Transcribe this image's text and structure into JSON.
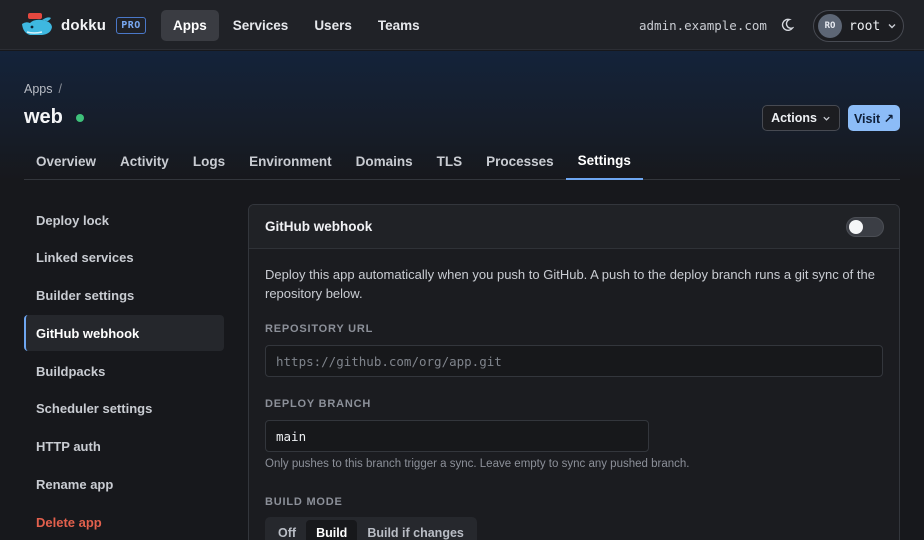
{
  "nav": {
    "brand": "dokku",
    "badge": "PRO",
    "links": [
      "Apps",
      "Services",
      "Users",
      "Teams"
    ],
    "active": "Apps",
    "host": "admin.example.com",
    "user_initials": "RO",
    "user_name": "root"
  },
  "header": {
    "breadcrumb": "Apps",
    "breadcrumb_sep": "/",
    "app_name": "web",
    "status": "running",
    "actions_label": "Actions",
    "visit_label": "Visit ↗"
  },
  "tabs": [
    "Overview",
    "Activity",
    "Logs",
    "Environment",
    "Domains",
    "TLS",
    "Processes",
    "Settings"
  ],
  "active_tab": "Settings",
  "sidebar": {
    "items": [
      "Deploy lock",
      "Linked services",
      "Builder settings",
      "GitHub webhook",
      "Buildpacks",
      "Scheduler settings",
      "HTTP auth",
      "Rename app",
      "Delete app"
    ],
    "active": "GitHub webhook",
    "danger": "Delete app"
  },
  "panel": {
    "title": "GitHub webhook",
    "enabled": false,
    "description": "Deploy this app automatically when you push to GitHub. A push to the deploy branch runs a git sync of the repository below.",
    "repo_label": "REPOSITORY URL",
    "repo_placeholder": "https://github.com/org/app.git",
    "branch_label": "DEPLOY BRANCH",
    "branch_value": "main",
    "branch_hint": "Only pushes to this branch trigger a sync. Leave empty to sync any pushed branch.",
    "mode_label": "BUILD MODE",
    "modes": [
      "Off",
      "Build",
      "Build if changes"
    ],
    "mode_selected": "Build"
  },
  "colors": {
    "accent": "#6ea6f0",
    "visit_button": "#8cbcf7",
    "status_running": "#3ec17a",
    "danger": "#e2604d"
  }
}
